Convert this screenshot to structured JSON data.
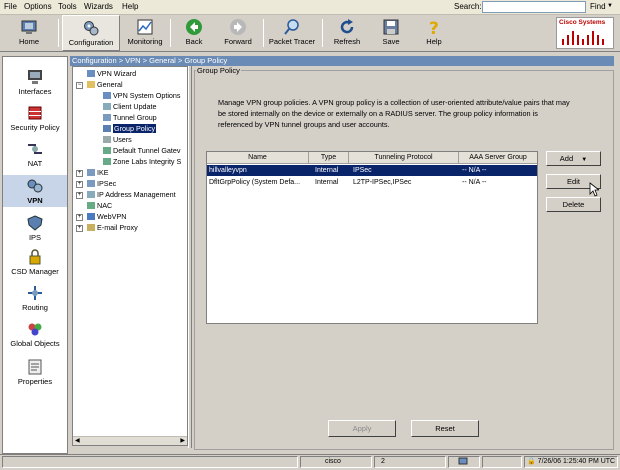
{
  "menu": {
    "items": [
      "File",
      "Options",
      "Tools",
      "Wizards",
      "Help"
    ],
    "search_label": "Search:",
    "search_value": "",
    "find_label": "Find"
  },
  "toolbar": {
    "home": "Home",
    "configuration": "Configuration",
    "monitoring": "Monitoring",
    "back": "Back",
    "forward": "Forward",
    "packet_tracer": "Packet Tracer",
    "refresh": "Refresh",
    "save": "Save",
    "help": "Help",
    "logo_text": "Cisco Systems"
  },
  "nav": {
    "interfaces": "Interfaces",
    "security_policy": "Security Policy",
    "nat": "NAT",
    "vpn": "VPN",
    "ips": "IPS",
    "csd_manager": "CSD Manager",
    "routing": "Routing",
    "global_objects": "Global Objects",
    "properties": "Properties"
  },
  "breadcrumb": "Configuration > VPN > General > Group Policy",
  "tree": {
    "vpn_wizard": "VPN Wizard",
    "general": "General",
    "vpn_system_options": "VPN System Options",
    "client_update": "Client Update",
    "tunnel_group": "Tunnel Group",
    "group_policy": "Group Policy",
    "users": "Users",
    "default_tunnel_gateway": "Default Tunnel Gatev",
    "zone_labs": "Zone Labs Integrity S",
    "ike": "IKE",
    "ipsec": "IPSec",
    "ip_address_mgmt": "IP Address Management",
    "nac": "NAC",
    "webvpn": "WebVPN",
    "email_proxy": "E-mail Proxy"
  },
  "panel": {
    "title": "Group Policy",
    "description": "Manage VPN group policies. A VPN group policy is a collection of user-oriented attribute/value pairs that may be stored internally on the device or externally on a RADIUS server. The group policy information is referenced by VPN tunnel groups and user accounts.",
    "columns": [
      "Name",
      "Type",
      "Tunneling Protocol",
      "AAA Server Group"
    ],
    "rows": [
      [
        "hillvalleyvpn",
        "Internal",
        "IPSec",
        "-- N/A --"
      ],
      [
        "DfltGrpPolicy (System Defa...",
        "Internal",
        "L2TP-IPSec,IPSec",
        "-- N/A --"
      ]
    ],
    "add_label": "Add",
    "edit_label": "Edit",
    "delete_label": "Delete",
    "apply_label": "Apply",
    "reset_label": "Reset"
  },
  "status": {
    "user": "cisco",
    "count": "2",
    "datetime": "7/26/06 1:25:40 PM UTC"
  }
}
